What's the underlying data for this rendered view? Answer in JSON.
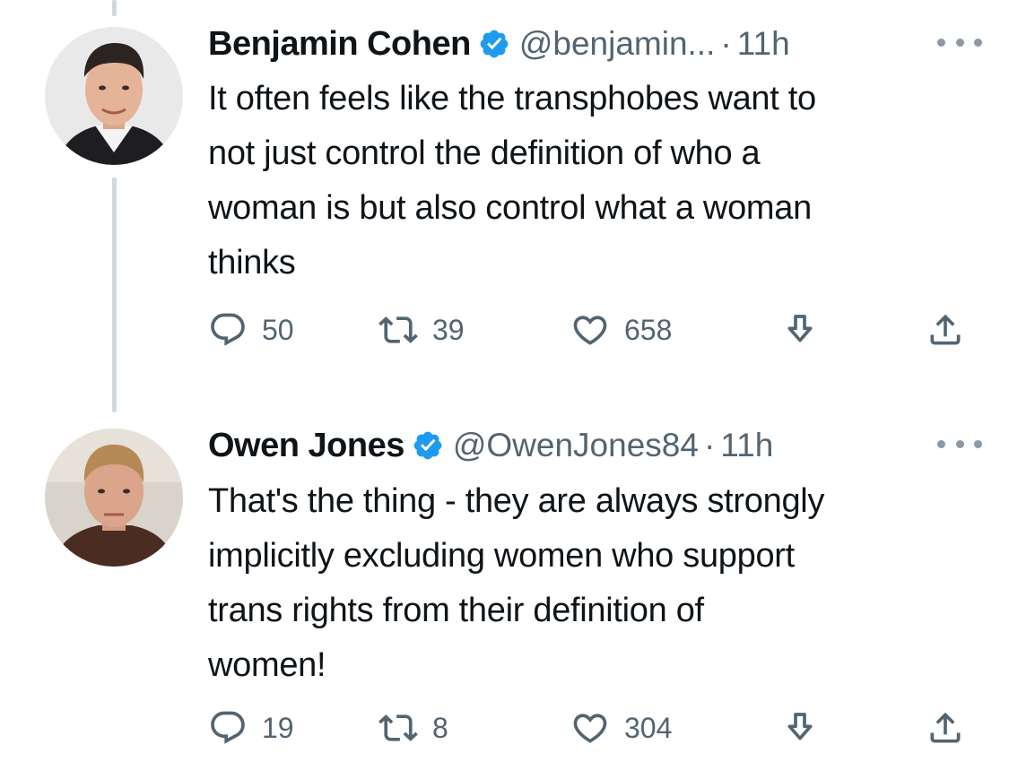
{
  "tweets": [
    {
      "author": {
        "name": "Benjamin Cohen",
        "handle": "@benjamin...",
        "verified": true,
        "avatar": "avatar-benjamin-cohen"
      },
      "separator": "·",
      "time": "11h",
      "text_lines": [
        "It often feels like the transphobes want to",
        "not just control the definition of who a",
        "woman is but also control what a woman",
        "thinks"
      ],
      "stats": {
        "replies": "50",
        "retweets": "39",
        "likes": "658"
      }
    },
    {
      "author": {
        "name": "Owen Jones",
        "handle": "@OwenJones84",
        "verified": true,
        "avatar": "avatar-owen-jones"
      },
      "separator": "·",
      "time": "11h",
      "text_lines": [
        "That's the thing - they are always strongly",
        "implicitly excluding women who support",
        "trans rights from their definition of",
        "women!"
      ],
      "stats": {
        "replies": "19",
        "retweets": "8",
        "likes": "304"
      }
    }
  ],
  "icons": {
    "verified": "verified-badge-icon",
    "more": "more-options-icon",
    "reply": "reply-icon",
    "retweet": "retweet-icon",
    "like": "heart-icon",
    "bookmark": "bookmark-icon",
    "share": "share-icon"
  },
  "colors": {
    "verified_blue": "#1d9bf0",
    "text_primary": "#0f1419",
    "text_secondary": "#536471",
    "thread_line": "#cfd9de"
  }
}
